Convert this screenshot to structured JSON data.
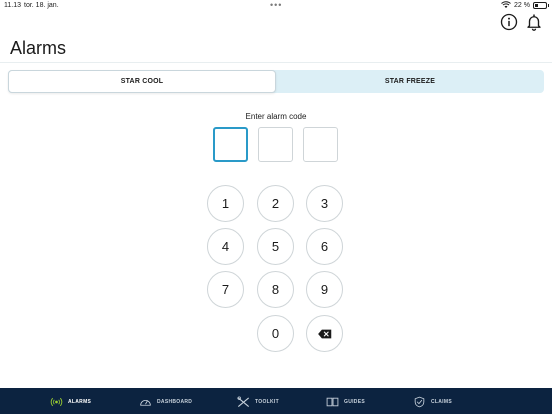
{
  "status_bar": {
    "time": "11.13",
    "date": "tor. 18. jan.",
    "dots": "•••",
    "battery_pct": "22 %"
  },
  "header": {
    "title": "Alarms",
    "info_icon": "info-icon",
    "bell_icon": "bell-icon"
  },
  "segments": {
    "items": [
      {
        "label": "STAR COOL",
        "active": true
      },
      {
        "label": "STAR FREEZE",
        "active": false
      }
    ]
  },
  "code_entry": {
    "label": "Enter alarm code",
    "digits": [
      "",
      "",
      ""
    ]
  },
  "keypad": {
    "keys": [
      "1",
      "2",
      "3",
      "4",
      "5",
      "6",
      "7",
      "8",
      "9",
      "0"
    ],
    "backspace_icon": "backspace-icon"
  },
  "tab_bar": {
    "tabs": [
      {
        "label": "ALARMS",
        "icon": "alarm-signal-icon",
        "active": true
      },
      {
        "label": "DASHBOARD",
        "icon": "gauge-icon",
        "active": false
      },
      {
        "label": "TOOLKIT",
        "icon": "tools-icon",
        "active": false
      },
      {
        "label": "GUIDES",
        "icon": "book-icon",
        "active": false
      },
      {
        "label": "CLAIMS",
        "icon": "shield-check-icon",
        "active": false
      }
    ]
  },
  "colors": {
    "accent": "#2a9ac8",
    "segment_bg": "#dceff6",
    "tab_bar_bg": "#0c2340",
    "active_tab_icon": "#9acd32"
  }
}
